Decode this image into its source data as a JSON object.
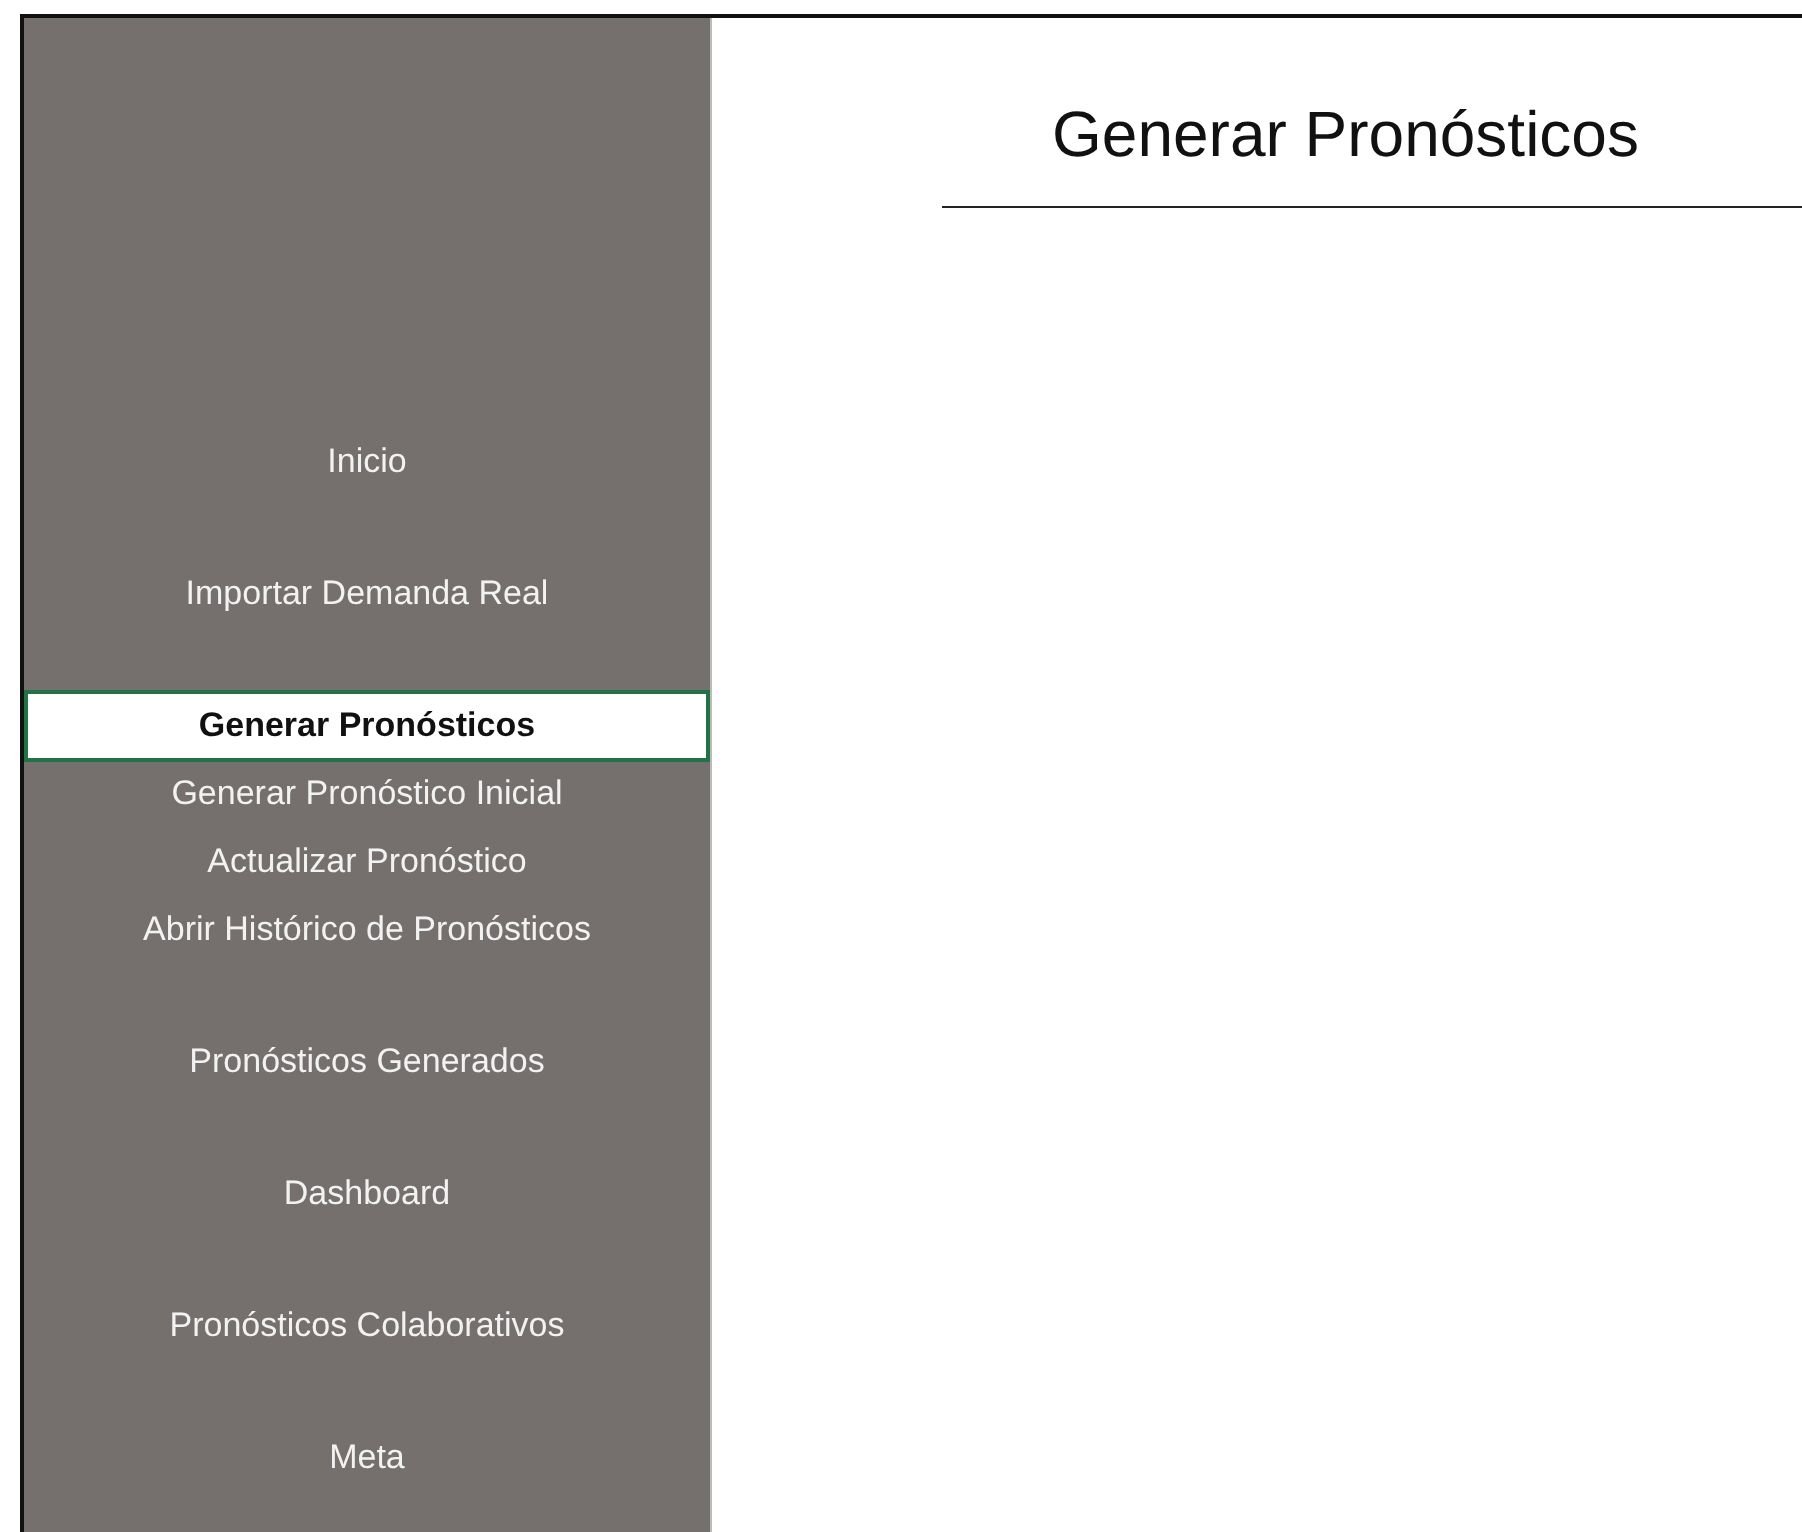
{
  "sidebar": {
    "items": [
      {
        "label": "Inicio",
        "kind": "link",
        "selected": false
      },
      {
        "label": "Importar Demanda Real",
        "kind": "link",
        "selected": false
      },
      {
        "label": "Generar Pronósticos",
        "kind": "section",
        "selected": true
      },
      {
        "label": "Generar Pronóstico Inicial",
        "kind": "sub",
        "selected": false
      },
      {
        "label": "Actualizar Pronóstico",
        "kind": "sub",
        "selected": false
      },
      {
        "label": "Abrir Histórico de Pronósticos",
        "kind": "sub",
        "selected": false
      },
      {
        "label": "Pronósticos Generados",
        "kind": "link",
        "selected": false
      },
      {
        "label": "Dashboard",
        "kind": "link",
        "selected": false
      },
      {
        "label": "Pronósticos Colaborativos",
        "kind": "link",
        "selected": false
      },
      {
        "label": "Meta",
        "kind": "link",
        "selected": false
      }
    ]
  },
  "page": {
    "title": "Generar Pronósticos"
  }
}
